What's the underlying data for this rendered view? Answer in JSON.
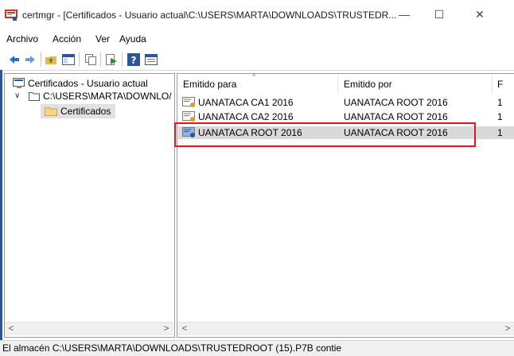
{
  "window": {
    "title": "certmgr - [Certificados - Usuario actual\\C:\\USERS\\MARTA\\DOWNLOADS\\TRUSTEDR...",
    "minimize_glyph": "—",
    "maximize_glyph": "☐",
    "close_glyph": "✕"
  },
  "menu": {
    "items": [
      {
        "label": "Archivo"
      },
      {
        "label": "Acción"
      },
      {
        "label": "Ver"
      },
      {
        "label": "Ayuda"
      }
    ]
  },
  "toolbar": {
    "icons": [
      "back-arrow-icon",
      "forward-arrow-icon",
      "up-folder-icon",
      "show-tree-icon",
      "copy-icon",
      "export-icon",
      "help-icon",
      "properties-icon"
    ]
  },
  "tree": {
    "root_label": "Certificados - Usuario actual",
    "store_label": "C:\\USERS\\MARTA\\DOWNLO/",
    "child_label": "Certificados"
  },
  "list": {
    "columns": [
      "Emitido para",
      "Emitido por",
      "F"
    ],
    "rows": [
      {
        "issued_to": "UANATACA CA1 2016",
        "issued_by": "UANATACA ROOT 2016",
        "extra": "1"
      },
      {
        "issued_to": "UANATACA CA2 2016",
        "issued_by": "UANATACA ROOT 2016",
        "extra": "1"
      },
      {
        "issued_to": "UANATACA ROOT 2016",
        "issued_by": "UANATACA ROOT 2016",
        "extra": "1"
      }
    ]
  },
  "status": {
    "text": "El almacén C:\\USERS\\MARTA\\DOWNLOADS\\TRUSTEDROOT (15).P7B contie"
  },
  "colors": {
    "highlight": "#e8151b",
    "accent": "#2b579a",
    "selected_row": "#d9d9d9"
  }
}
